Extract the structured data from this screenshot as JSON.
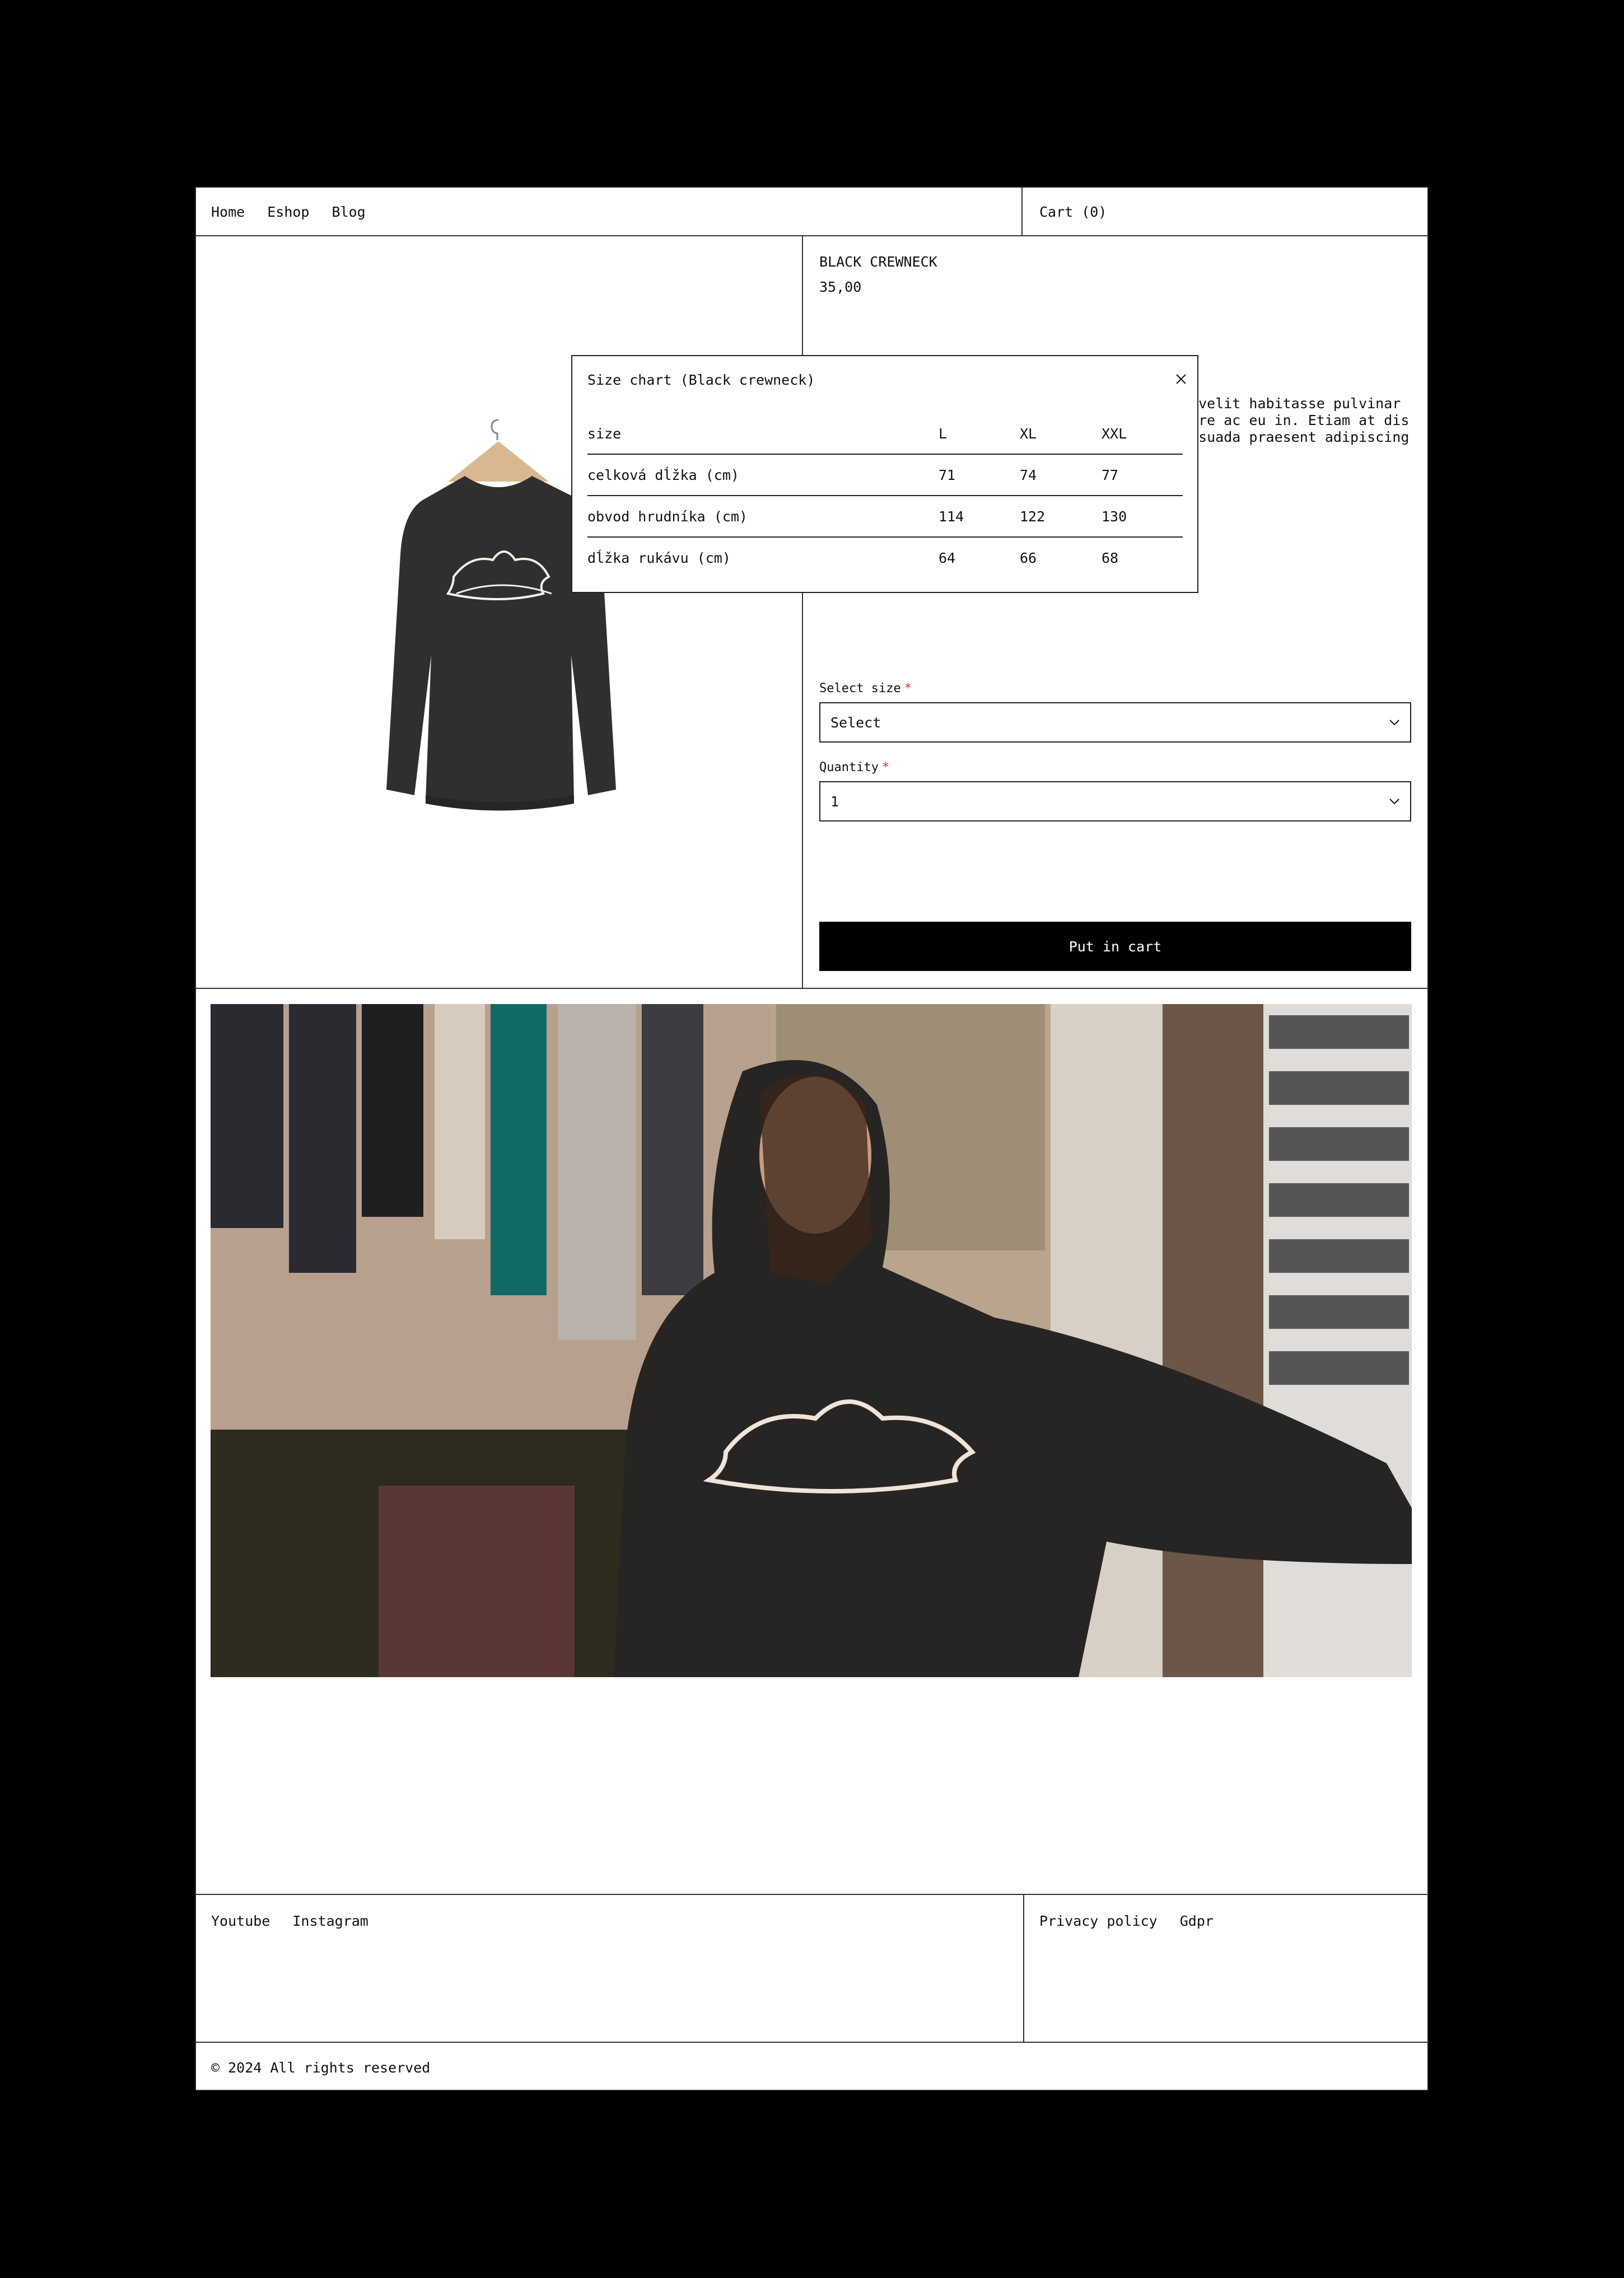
{
  "nav": {
    "home": "Home",
    "eshop": "Eshop",
    "blog": "Blog",
    "cart": "Cart (0)"
  },
  "product": {
    "title": "BLACK CREWNECK",
    "price": "35,00",
    "description_lines": [
      "t velit habitasse pulvinar",
      "hare ac eu in. Etiam at dis",
      "lesuada praesent adipiscing"
    ]
  },
  "form": {
    "size_label": "Select size",
    "size_value": "Select",
    "qty_label": "Quantity",
    "qty_value": "1",
    "required_mark": "*",
    "submit": "Put in cart"
  },
  "size_chart": {
    "title": "Size chart (Black crewneck)",
    "headers": [
      "size",
      "L",
      "XL",
      "XXL"
    ],
    "rows": [
      [
        "celková dĺžka (cm)",
        "71",
        "74",
        "77"
      ],
      [
        "obvod hrudníka (cm)",
        "114",
        "122",
        "130"
      ],
      [
        "dĺžka rukávu (cm)",
        "64",
        "66",
        "68"
      ]
    ]
  },
  "footer": {
    "youtube": "Youtube",
    "instagram": "Instagram",
    "privacy": "Privacy policy",
    "gdpr": "Gdpr",
    "copyright": "© 2024 All rights reserved"
  },
  "colors": {
    "background": "#000000",
    "panel": "#ffffff",
    "required": "#d0312d",
    "button": "#000000"
  }
}
